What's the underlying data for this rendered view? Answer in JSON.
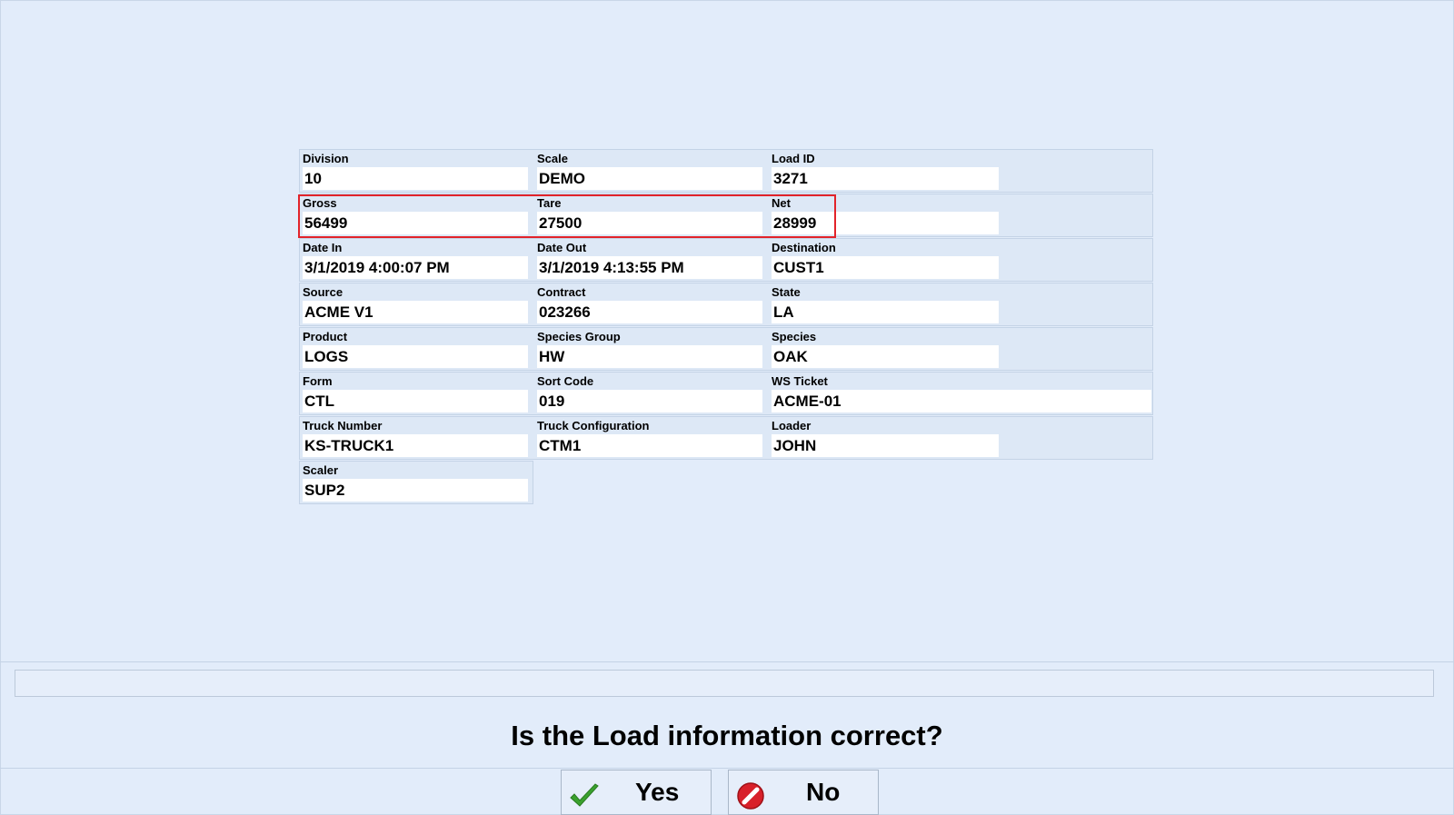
{
  "fields": {
    "division": {
      "label": "Division",
      "value": "10"
    },
    "scale": {
      "label": "Scale",
      "value": "DEMO"
    },
    "load_id": {
      "label": "Load ID",
      "value": "3271"
    },
    "gross": {
      "label": "Gross",
      "value": "56499"
    },
    "tare": {
      "label": "Tare",
      "value": "27500"
    },
    "net": {
      "label": "Net",
      "value": "28999"
    },
    "date_in": {
      "label": "Date In",
      "value": "3/1/2019 4:00:07 PM"
    },
    "date_out": {
      "label": "Date Out",
      "value": "3/1/2019 4:13:55 PM"
    },
    "destination": {
      "label": "Destination",
      "value": "CUST1"
    },
    "source": {
      "label": "Source",
      "value": "ACME V1"
    },
    "contract": {
      "label": "Contract",
      "value": "023266"
    },
    "state": {
      "label": "State",
      "value": "LA"
    },
    "product": {
      "label": "Product",
      "value": "LOGS"
    },
    "species_group": {
      "label": "Species Group",
      "value": "HW"
    },
    "species": {
      "label": "Species",
      "value": "OAK"
    },
    "form": {
      "label": "Form",
      "value": "CTL"
    },
    "sort_code": {
      "label": "Sort Code",
      "value": "019"
    },
    "ws_ticket": {
      "label": "WS Ticket",
      "value": "ACME-01"
    },
    "truck_number": {
      "label": "Truck Number",
      "value": "KS-TRUCK1"
    },
    "truck_configuration": {
      "label": "Truck Configuration",
      "value": "CTM1"
    },
    "loader": {
      "label": "Loader",
      "value": "JOHN"
    },
    "scaler": {
      "label": "Scaler",
      "value": "SUP2"
    }
  },
  "prompt": {
    "question": "Is the Load information correct?"
  },
  "buttons": {
    "yes": "Yes",
    "no": "No"
  },
  "icons": {
    "yes": "checkmark-icon",
    "no": "no-entry-icon"
  },
  "colors": {
    "highlight": "#e2232a",
    "background": "#e2ecfa",
    "check": "#3aa12e",
    "no": "#d8202a"
  }
}
